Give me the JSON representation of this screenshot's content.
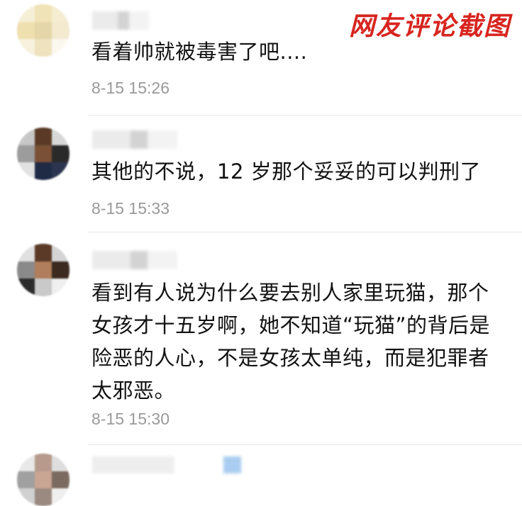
{
  "watermark": "网友评论截图",
  "comments": [
    {
      "text": "看着帅就被毒害了吧....",
      "time": "8-15 15:26"
    },
    {
      "text": "其他的不说，12 岁那个妥妥的可以判刑了",
      "time": "8-15 15:33"
    },
    {
      "text": "看到有人说为什么要去别人家里玩猫，那个女孩才十五岁啊，她不知道“玩猫”的背后是险恶的人心，不是女孩太单纯，而是犯罪者太邪恶。",
      "time": "8-15 15:30"
    }
  ],
  "colors": {
    "stamp": "#d8251f",
    "time": "#9a9a9a",
    "text": "#111111",
    "divider": "#e6e6e6"
  }
}
